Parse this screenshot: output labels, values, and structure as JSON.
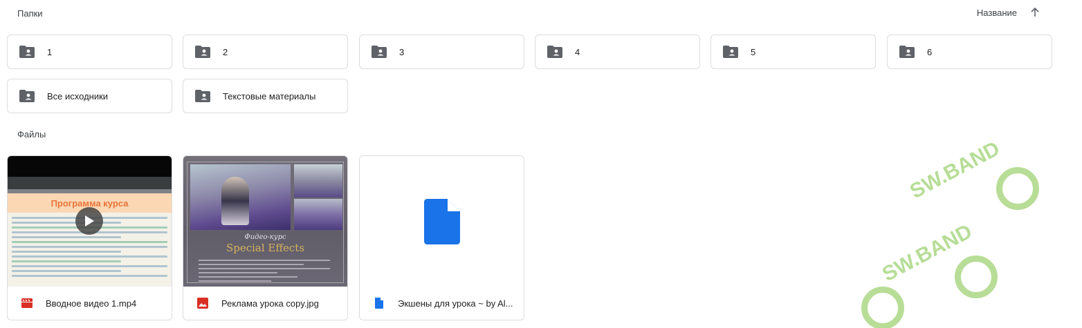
{
  "sections": {
    "folders_label": "Папки",
    "files_label": "Файлы"
  },
  "sort": {
    "label": "Название",
    "direction_icon": "arrow-up-icon"
  },
  "folders": [
    {
      "label": "1",
      "icon": "shared-folder-icon"
    },
    {
      "label": "2",
      "icon": "shared-folder-icon"
    },
    {
      "label": "3",
      "icon": "shared-folder-icon"
    },
    {
      "label": "4",
      "icon": "shared-folder-icon"
    },
    {
      "label": "5",
      "icon": "shared-folder-icon"
    },
    {
      "label": "6",
      "icon": "shared-folder-icon"
    },
    {
      "label": "Все исходники",
      "icon": "shared-folder-icon"
    },
    {
      "label": "Текстовые материалы",
      "icon": "shared-folder-icon"
    }
  ],
  "files": [
    {
      "label": "Вводное видео 1.mp4",
      "type": "video",
      "icon": "video-file-icon",
      "thumb_heading": "Программа курса"
    },
    {
      "label": "Реклама урока copy.jpg",
      "type": "image",
      "icon": "image-file-icon",
      "thumb_subtitle": "Фидео-курс",
      "thumb_title": "Special Effects"
    },
    {
      "label": "Экшены для урока ~ by Al...",
      "type": "document",
      "icon": "document-file-icon"
    }
  ],
  "watermark": {
    "text": "SW.BAND"
  },
  "colors": {
    "folder_icon": "#5f6368",
    "video_icon": "#d93025",
    "image_icon": "#d93025",
    "doc_icon": "#1a73e8",
    "border": "#dadce0",
    "watermark": "#7dc243"
  }
}
